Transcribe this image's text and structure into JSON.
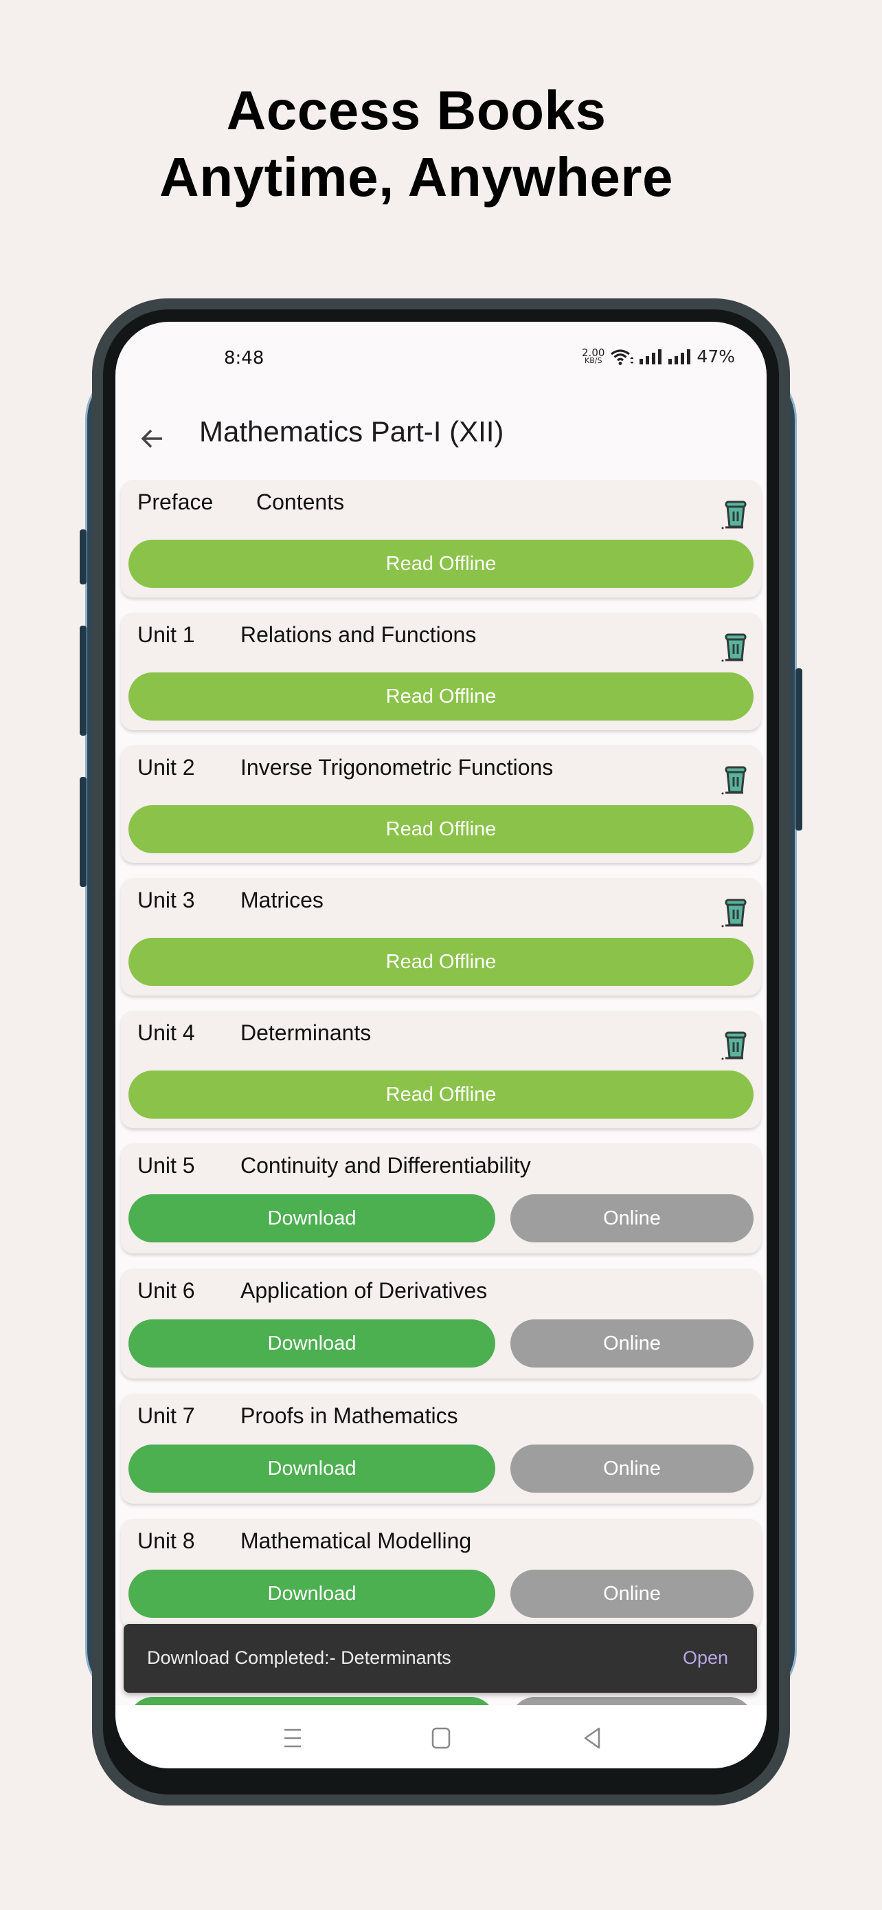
{
  "promo": {
    "headline_line1": "Access Books",
    "headline_line2": "Anytime, Anywhere"
  },
  "status_bar": {
    "time": "8:48",
    "net_speed_value": "2.00",
    "net_speed_unit": "KB/S",
    "battery": "47%"
  },
  "app_bar": {
    "back_icon": "arrow-left-icon",
    "title": "Mathematics Part-I (XII)"
  },
  "colors": {
    "read_offline": "#8bc34a",
    "download": "#4caf50",
    "online": "#9e9e9e",
    "snackbar_action": "#b8a6e8"
  },
  "chapters": [
    {
      "number": "Preface",
      "title": "Contents",
      "state": "downloaded",
      "primary_label": "Read Offline",
      "delete_icon": "trash-icon"
    },
    {
      "number": "Unit 1",
      "title": "Relations and Functions",
      "state": "downloaded",
      "primary_label": "Read Offline",
      "delete_icon": "trash-icon"
    },
    {
      "number": "Unit 2",
      "title": "Inverse Trigonometric Functions",
      "state": "downloaded",
      "primary_label": "Read Offline",
      "delete_icon": "trash-icon"
    },
    {
      "number": "Unit 3",
      "title": "Matrices",
      "state": "downloaded",
      "primary_label": "Read Offline",
      "delete_icon": "trash-icon"
    },
    {
      "number": "Unit 4",
      "title": "Determinants",
      "state": "downloaded",
      "primary_label": "Read Offline",
      "delete_icon": "trash-icon"
    },
    {
      "number": "Unit 5",
      "title": "Continuity and Differentiability",
      "state": "not_downloaded",
      "primary_label": "Download",
      "secondary_label": "Online"
    },
    {
      "number": "Unit 6",
      "title": "Application of Derivatives",
      "state": "not_downloaded",
      "primary_label": "Download",
      "secondary_label": "Online"
    },
    {
      "number": "Unit 7",
      "title": "Proofs in Mathematics",
      "state": "not_downloaded",
      "primary_label": "Download",
      "secondary_label": "Online"
    },
    {
      "number": "Unit 8",
      "title": "Mathematical Modelling",
      "state": "not_downloaded",
      "primary_label": "Download",
      "secondary_label": "Online"
    }
  ],
  "snackbar": {
    "message": "Download Completed:-  Determinants",
    "action": "Open"
  },
  "nav_bar": {
    "recents_icon": "recents-icon",
    "home_icon": "home-icon",
    "back_icon": "back-triangle-icon"
  }
}
